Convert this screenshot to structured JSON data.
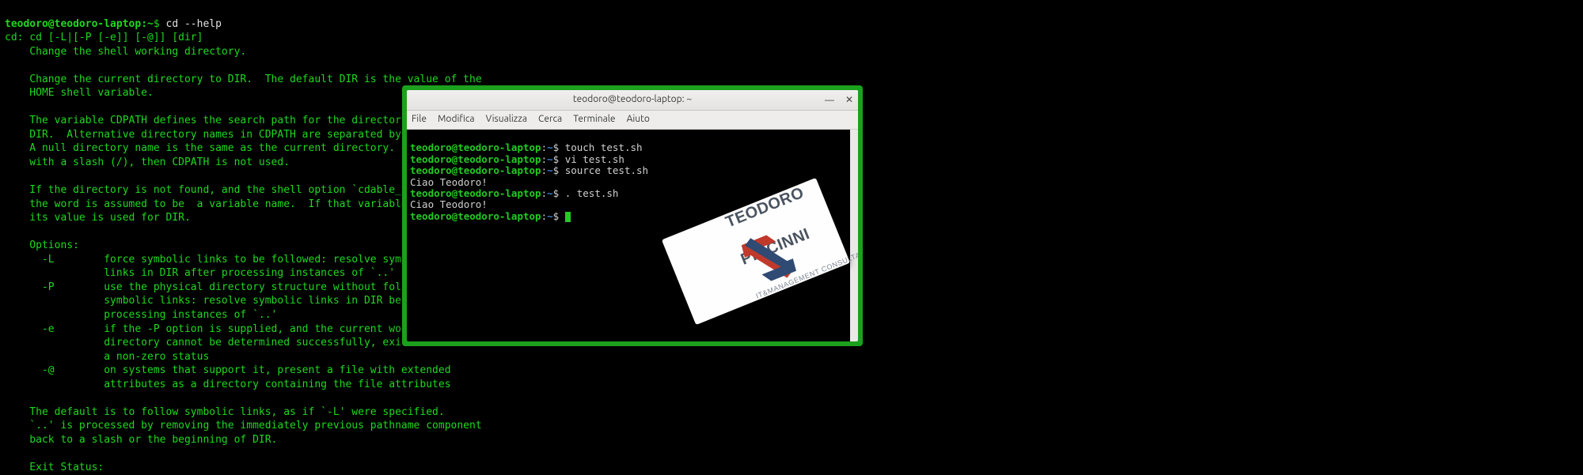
{
  "bg": {
    "prompt": {
      "user": "teodoro@teodoro-laptop",
      "path": "~",
      "sep": ":",
      "dollar": "$"
    },
    "command": "cd --help",
    "lines": [
      "cd: cd [-L|[-P [-e]] [-@]] [dir]",
      "    Change the shell working directory.",
      "",
      "    Change the current directory to DIR.  The default DIR is the value of the",
      "    HOME shell variable.",
      "",
      "    The variable CDPATH defines the search path for the directory containing",
      "    DIR.  Alternative directory names in CDPATH are separated by a colon (:).",
      "    A null directory name is the same as the current directory.  If DIR begins",
      "    with a slash (/), then CDPATH is not used.",
      "",
      "    If the directory is not found, and the shell option `cdable_vars' is set,",
      "    the word is assumed to be  a variable name.  If that variable has a value,",
      "    its value is used for DIR.",
      "",
      "    Options:",
      "      -L        force symbolic links to be followed: resolve symbolic",
      "                links in DIR after processing instances of `..'",
      "      -P        use the physical directory structure without following",
      "                symbolic links: resolve symbolic links in DIR before",
      "                processing instances of `..'",
      "      -e        if the -P option is supplied, and the current working",
      "                directory cannot be determined successfully, exit with",
      "                a non-zero status",
      "      -@        on systems that support it, present a file with extended",
      "                attributes as a directory containing the file attributes",
      "",
      "    The default is to follow symbolic links, as if `-L' were specified.",
      "    `..' is processed by removing the immediately previous pathname component",
      "    back to a slash or the beginning of DIR.",
      "",
      "    Exit Status:"
    ]
  },
  "fg": {
    "title": "teodoro@teodoro-laptop: ~",
    "menu": [
      "File",
      "Modifica",
      "Visualizza",
      "Cerca",
      "Terminale",
      "Aiuto"
    ],
    "prompt": {
      "user": "teodoro@teodoro-laptop",
      "path": "~",
      "sep": ":",
      "dollar": "$"
    },
    "rows": [
      {
        "type": "cmd",
        "text": "touch test.sh"
      },
      {
        "type": "cmd",
        "text": "vi test.sh"
      },
      {
        "type": "cmd",
        "text": "source test.sh"
      },
      {
        "type": "out",
        "text": "Ciao Teodoro!"
      },
      {
        "type": "cmd",
        "text": ". test.sh"
      },
      {
        "type": "out",
        "text": "Ciao Teodoro!"
      },
      {
        "type": "cmd",
        "text": ""
      }
    ]
  },
  "logo": {
    "line1": "TEODORO",
    "line2": "PICCINNI",
    "line3": "IT&MANAGEMENT CONSULTANT"
  }
}
